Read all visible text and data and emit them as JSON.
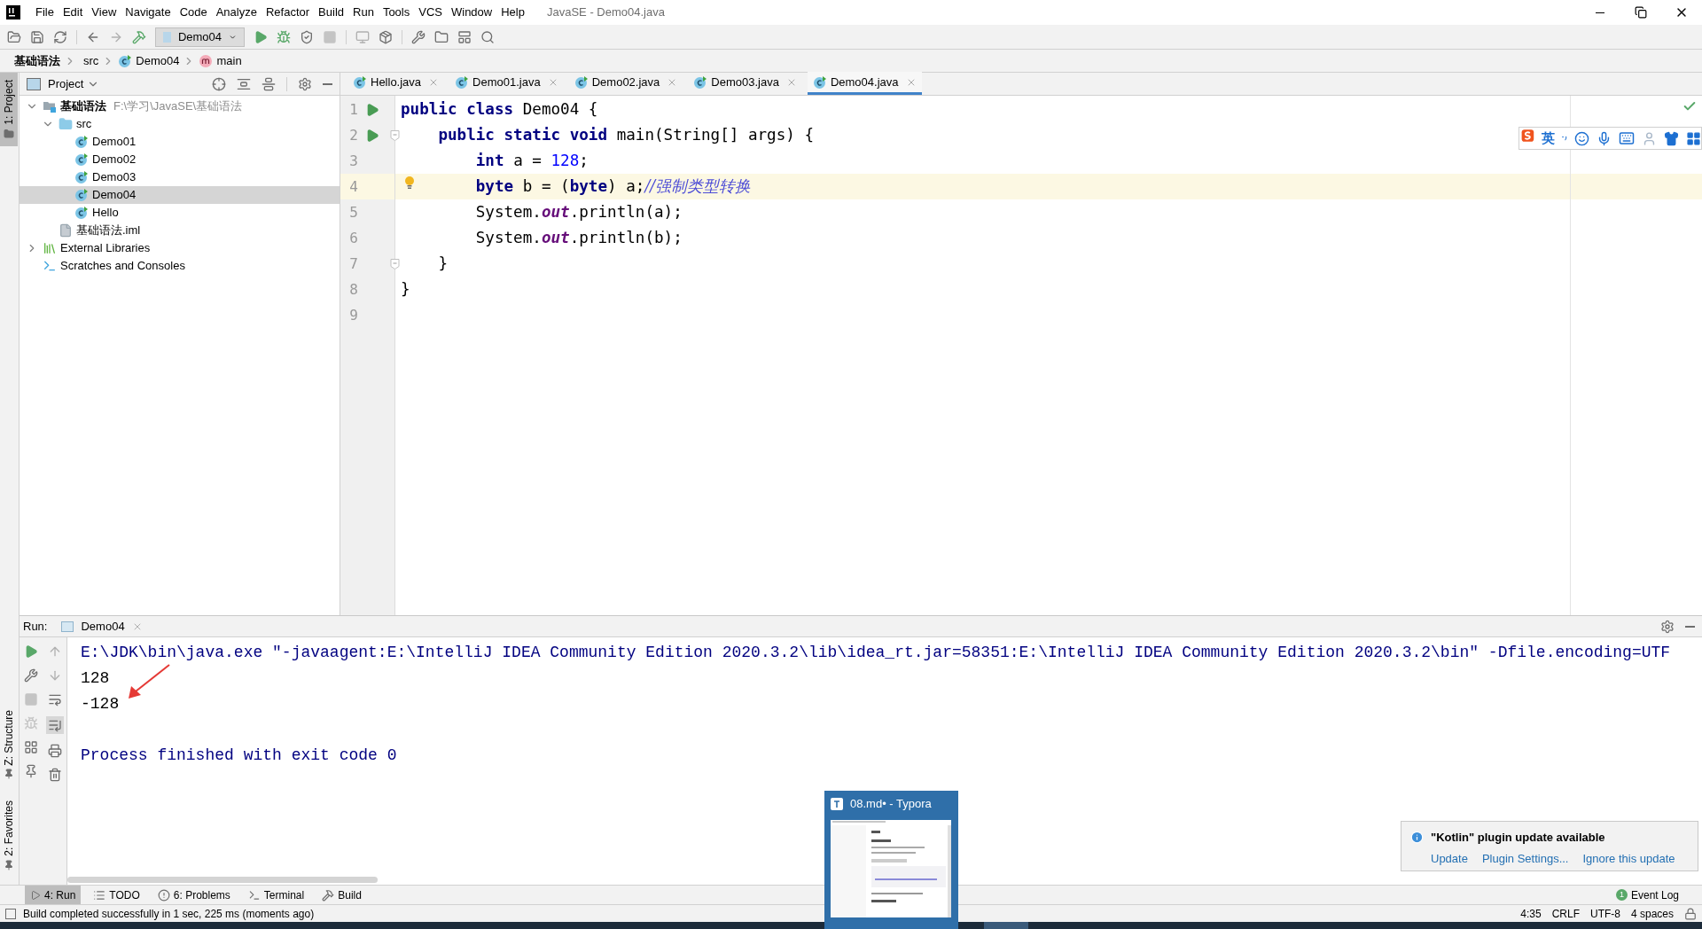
{
  "window": {
    "title": "JavaSE - Demo04.java"
  },
  "menu": [
    "File",
    "Edit",
    "View",
    "Navigate",
    "Code",
    "Analyze",
    "Refactor",
    "Build",
    "Run",
    "Tools",
    "VCS",
    "Window",
    "Help"
  ],
  "toolbar": {
    "run_config": "Demo04"
  },
  "breadcrumbs": [
    {
      "label": "基础语法",
      "kind": "project"
    },
    {
      "label": "src",
      "kind": "folder"
    },
    {
      "label": "Demo04",
      "kind": "class"
    },
    {
      "label": "main",
      "kind": "method"
    }
  ],
  "side_tabs_top": [
    {
      "label": "1: Project",
      "selected": true
    }
  ],
  "side_tabs_bottom": [
    {
      "label": "Z: Structure",
      "selected": false
    },
    {
      "label": "2: Favorites",
      "selected": false
    }
  ],
  "project_panel": {
    "title": "Project",
    "tree": [
      {
        "label": "基础语法",
        "path": "F:\\学习\\JavaSE\\基础语法",
        "kind": "module",
        "expanded": true,
        "selected": false,
        "children": [
          {
            "label": "src",
            "kind": "folder",
            "expanded": true,
            "selected": false,
            "children": [
              {
                "label": "Demo01",
                "kind": "class",
                "selected": false
              },
              {
                "label": "Demo02",
                "kind": "class",
                "selected": false
              },
              {
                "label": "Demo03",
                "kind": "class",
                "selected": false
              },
              {
                "label": "Demo04",
                "kind": "class",
                "selected": true
              },
              {
                "label": "Hello",
                "kind": "class",
                "selected": false
              }
            ]
          },
          {
            "label": "基础语法.iml",
            "kind": "file",
            "selected": false
          }
        ]
      },
      {
        "label": "External Libraries",
        "kind": "library",
        "expanded": false,
        "selected": false
      },
      {
        "label": "Scratches and Consoles",
        "kind": "scratch",
        "selected": false
      }
    ]
  },
  "editor_tabs": [
    {
      "label": "Hello.java",
      "selected": false
    },
    {
      "label": "Demo01.java",
      "selected": false
    },
    {
      "label": "Demo02.java",
      "selected": false
    },
    {
      "label": "Demo03.java",
      "selected": false
    },
    {
      "label": "Demo04.java",
      "selected": true
    }
  ],
  "editor": {
    "lines": [
      {
        "number": "1",
        "run": true,
        "fold": false,
        "current": false,
        "intention": false,
        "tokens": [
          {
            "kind": "keyword",
            "text": "public class "
          },
          {
            "kind": "plain",
            "text": "Demo04 {"
          }
        ]
      },
      {
        "number": "2",
        "run": true,
        "fold": true,
        "current": false,
        "intention": false,
        "tokens": [
          {
            "kind": "keyword",
            "text": "    public static void "
          },
          {
            "kind": "plain",
            "text": "main(String[] args) {"
          }
        ]
      },
      {
        "number": "3",
        "run": false,
        "fold": false,
        "current": false,
        "intention": false,
        "tokens": [
          {
            "kind": "keyword",
            "text": "        int "
          },
          {
            "kind": "plain",
            "text": "a = "
          },
          {
            "kind": "number",
            "text": "128"
          },
          {
            "kind": "plain",
            "text": ";"
          }
        ]
      },
      {
        "number": "4",
        "run": false,
        "fold": false,
        "current": true,
        "intention": true,
        "tokens": [
          {
            "kind": "keyword",
            "text": "        byte "
          },
          {
            "kind": "plain",
            "text": "b = ("
          },
          {
            "kind": "keyword",
            "text": "byte"
          },
          {
            "kind": "plain",
            "text": ") a;"
          },
          {
            "kind": "comment",
            "text": "//强制类型转换"
          }
        ]
      },
      {
        "number": "5",
        "run": false,
        "fold": false,
        "current": false,
        "intention": false,
        "tokens": [
          {
            "kind": "plain",
            "text": "        System."
          },
          {
            "kind": "field",
            "text": "out"
          },
          {
            "kind": "plain",
            "text": ".println(a);"
          }
        ]
      },
      {
        "number": "6",
        "run": false,
        "fold": false,
        "current": false,
        "intention": false,
        "tokens": [
          {
            "kind": "plain",
            "text": "        System."
          },
          {
            "kind": "field",
            "text": "out"
          },
          {
            "kind": "plain",
            "text": ".println(b);"
          }
        ]
      },
      {
        "number": "7",
        "run": false,
        "fold": true,
        "current": false,
        "intention": false,
        "tokens": [
          {
            "kind": "plain",
            "text": "    }"
          }
        ]
      },
      {
        "number": "8",
        "run": false,
        "fold": false,
        "current": false,
        "intention": false,
        "tokens": [
          {
            "kind": "plain",
            "text": "}"
          }
        ]
      },
      {
        "number": "9",
        "run": false,
        "fold": false,
        "current": false,
        "intention": false
      }
    ]
  },
  "ime_toolbar": {
    "mode": "英"
  },
  "run_panel": {
    "label": "Run:",
    "tab": "Demo04",
    "output": [
      {
        "kind": "command",
        "text": "E:\\JDK\\bin\\java.exe \"-javaagent:E:\\IntelliJ IDEA Community Edition 2020.3.2\\lib\\idea_rt.jar=58351:E:\\IntelliJ IDEA Community Edition 2020.3.2\\bin\" -Dfile.encoding=UTF"
      },
      {
        "kind": "stdout",
        "text": "128"
      },
      {
        "kind": "stdout",
        "text": "-128"
      },
      {
        "kind": "exit",
        "text": "Process finished with exit code 0"
      }
    ]
  },
  "tool_windows": [
    {
      "label": "4: Run",
      "kind": "run",
      "selected": true
    },
    {
      "label": "TODO",
      "kind": "todo",
      "selected": false
    },
    {
      "label": "6: Problems",
      "kind": "problems",
      "selected": false
    },
    {
      "label": "Terminal",
      "kind": "terminal",
      "selected": false
    },
    {
      "label": "Build",
      "kind": "build",
      "selected": false
    }
  ],
  "event_log": {
    "label": "Event Log",
    "count": "1"
  },
  "status_bar": {
    "message": "Build completed successfully in 1 sec, 225 ms (moments ago)",
    "position": "4:35",
    "line_separator": "CRLF",
    "encoding": "UTF-8",
    "indent": "4 spaces"
  },
  "notification": {
    "title": "\"Kotlin\" plugin update available",
    "actions": [
      "Update",
      "Plugin Settings...",
      "Ignore this update"
    ]
  },
  "taskbar_preview": {
    "title": "08.md• - Typora"
  }
}
